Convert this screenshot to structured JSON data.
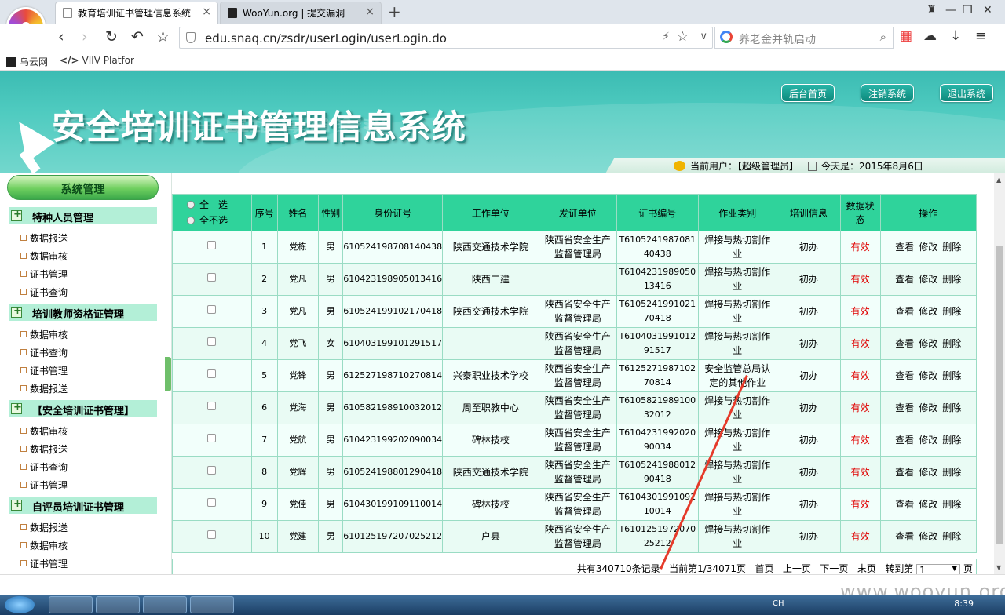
{
  "browser": {
    "tabs": [
      {
        "label": "教育培训证书管理信息系统",
        "active": true
      },
      {
        "label": "WooYun.org | 提交漏洞",
        "active": false
      }
    ],
    "url": "edu.snaq.cn/zsdr/userLogin/userLogin.do",
    "search_placeholder": "养老金并轨启动",
    "bookmarks": [
      "乌云网",
      "VIIV Platfor"
    ]
  },
  "header": {
    "title": "安全培训证书管理信息系统",
    "buttons": [
      "后台首页",
      "注销系统",
      "退出系统"
    ],
    "current_user": "当前用户：【超级管理员】",
    "today": "今天是：2015年8月6日"
  },
  "sidebar": {
    "title": "系统管理",
    "groups": [
      {
        "label": "特种人员管理",
        "items": [
          "数据报送",
          "数据审核",
          "证书管理",
          "证书查询"
        ]
      },
      {
        "label": "培训教师资格证管理",
        "items": [
          "数据审核",
          "证书查询",
          "证书管理",
          "数据报送"
        ]
      },
      {
        "label": "【安全培训证书管理】",
        "items": [
          "数据审核",
          "数据报送",
          "证书查询",
          "证书管理"
        ]
      },
      {
        "label": "自评员培训证书管理",
        "items": [
          "数据报送",
          "数据审核",
          "证书管理"
        ]
      }
    ]
  },
  "table": {
    "select_all": "全　选",
    "select_none": "全不选",
    "headers": [
      "序号",
      "姓名",
      "性别",
      "身份证号",
      "工作单位",
      "发证单位",
      "证书编号",
      "作业类别",
      "培训信息",
      "数据状态",
      "操作"
    ],
    "ops": [
      "查看",
      "修改",
      "删除"
    ],
    "rows": [
      {
        "no": "1",
        "name": "党栋",
        "sex": "男",
        "id": "610524198708140438",
        "unit": "陕西交通技术学院",
        "issuer": "陕西省安全生产监督管理局",
        "cert": "T610524198708140438",
        "category": "焊接与热切割作业",
        "training": "初办",
        "status": "有效"
      },
      {
        "no": "2",
        "name": "党凡",
        "sex": "男",
        "id": "610423198905013416",
        "unit": "陕西二建",
        "issuer": "",
        "cert": "T610423198905013416",
        "category": "焊接与热切割作业",
        "training": "初办",
        "status": "有效"
      },
      {
        "no": "3",
        "name": "党凡",
        "sex": "男",
        "id": "610524199102170418",
        "unit": "陕西交通技术学院",
        "issuer": "陕西省安全生产监督管理局",
        "cert": "T610524199102170418",
        "category": "焊接与热切割作业",
        "training": "初办",
        "status": "有效"
      },
      {
        "no": "4",
        "name": "党飞",
        "sex": "女",
        "id": "610403199101291517",
        "unit": "",
        "issuer": "陕西省安全生产监督管理局",
        "cert": "T610403199101291517",
        "category": "焊接与热切割作业",
        "training": "初办",
        "status": "有效"
      },
      {
        "no": "5",
        "name": "党锋",
        "sex": "男",
        "id": "612527198710270814",
        "unit": "兴泰职业技术学校",
        "issuer": "陕西省安全生产监督管理局",
        "cert": "T612527198710270814",
        "category": "安全监管总局认定的其他作业",
        "training": "初办",
        "status": "有效"
      },
      {
        "no": "6",
        "name": "党海",
        "sex": "男",
        "id": "610582198910032012",
        "unit": "周至职教中心",
        "issuer": "陕西省安全生产监督管理局",
        "cert": "T610582198910032012",
        "category": "焊接与热切割作业",
        "training": "初办",
        "status": "有效"
      },
      {
        "no": "7",
        "name": "党航",
        "sex": "男",
        "id": "610423199202090034",
        "unit": "碑林技校",
        "issuer": "陕西省安全生产监督管理局",
        "cert": "T610423199202090034",
        "category": "焊接与热切割作业",
        "training": "初办",
        "status": "有效"
      },
      {
        "no": "8",
        "name": "党辉",
        "sex": "男",
        "id": "610524198801290418",
        "unit": "陕西交通技术学院",
        "issuer": "陕西省安全生产监督管理局",
        "cert": "T610524198801290418",
        "category": "焊接与热切割作业",
        "training": "初办",
        "status": "有效"
      },
      {
        "no": "9",
        "name": "党佳",
        "sex": "男",
        "id": "610430199109110014",
        "unit": "碑林技校",
        "issuer": "陕西省安全生产监督管理局",
        "cert": "T610430199109110014",
        "category": "焊接与热切割作业",
        "training": "初办",
        "status": "有效"
      },
      {
        "no": "10",
        "name": "党建",
        "sex": "男",
        "id": "610125197207025212",
        "unit": "户县",
        "issuer": "陕西省安全生产监督管理局",
        "cert": "T610125197207025212",
        "category": "焊接与热切割作业",
        "training": "初办",
        "status": "有效"
      }
    ]
  },
  "pager": {
    "total": "共有340710条记录",
    "current": "当前第1/34071页",
    "first": "首页",
    "prev": "上一页",
    "next": "下一页",
    "last": "末页",
    "goto": "转到第",
    "page_value": "1",
    "page_suffix": "页"
  },
  "taskbar": {
    "time": "8:39",
    "lang": "CH"
  },
  "watermark": "www.wooyun.org",
  "colors": {
    "header_teal": "#3cbcb3",
    "table_header": "#2fd39b",
    "status_red": "#e00000",
    "sidebar_group": "#b3efd7"
  }
}
